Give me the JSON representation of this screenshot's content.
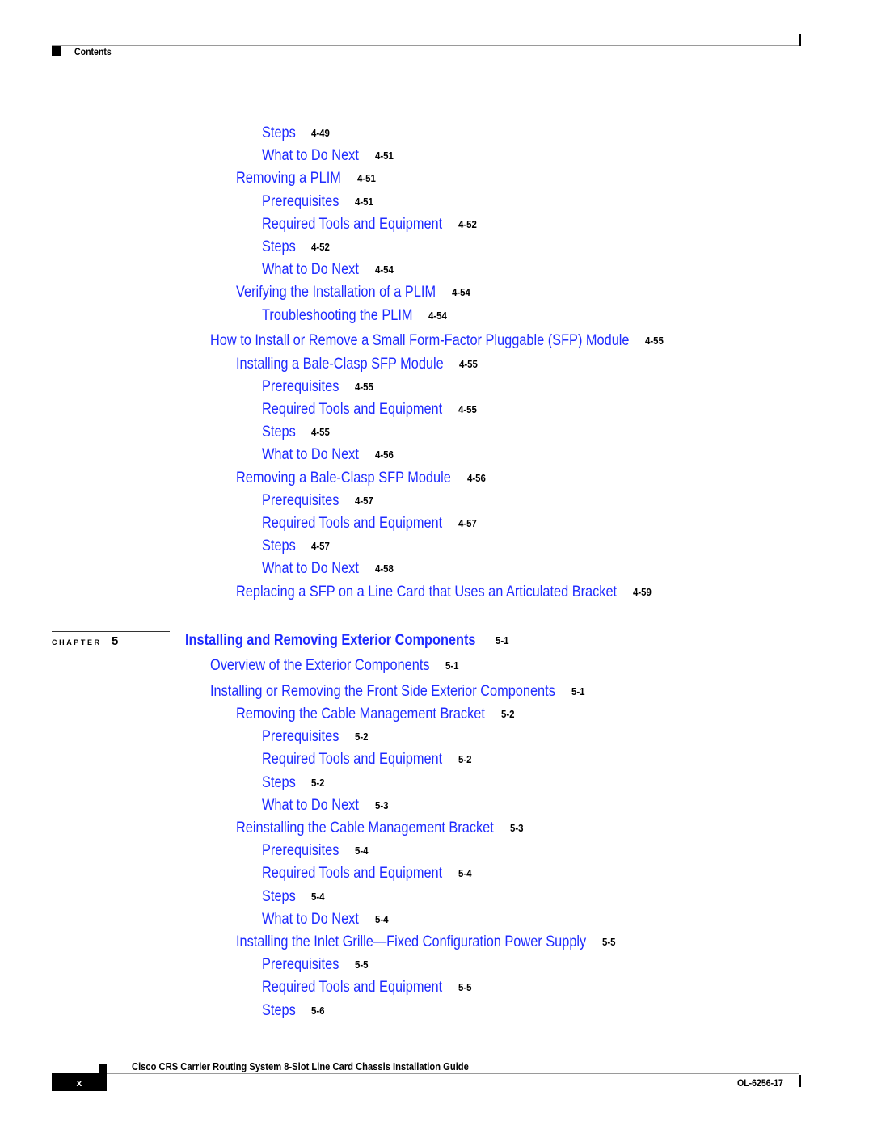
{
  "header": {
    "section_title": "Contents"
  },
  "toc_continued": [
    {
      "level": 3,
      "label": "Steps",
      "page": "4-49"
    },
    {
      "level": 3,
      "label": "What to Do Next",
      "page": "4-51"
    },
    {
      "level": 2,
      "label": "Removing a PLIM",
      "page": "4-51"
    },
    {
      "level": 3,
      "label": "Prerequisites",
      "page": "4-51"
    },
    {
      "level": 3,
      "label": "Required Tools and Equipment",
      "page": "4-52"
    },
    {
      "level": 3,
      "label": "Steps",
      "page": "4-52"
    },
    {
      "level": 3,
      "label": "What to Do Next",
      "page": "4-54"
    },
    {
      "level": 2,
      "label": "Verifying the Installation of a PLIM",
      "page": "4-54"
    },
    {
      "level": 3,
      "label": "Troubleshooting the PLIM",
      "page": "4-54"
    },
    {
      "level": 1,
      "label": "How to Install or Remove a Small Form-Factor Pluggable (SFP) Module",
      "page": "4-55"
    },
    {
      "level": 2,
      "label": "Installing a Bale-Clasp SFP Module",
      "page": "4-55"
    },
    {
      "level": 3,
      "label": "Prerequisites",
      "page": "4-55"
    },
    {
      "level": 3,
      "label": "Required Tools and Equipment",
      "page": "4-55"
    },
    {
      "level": 3,
      "label": "Steps",
      "page": "4-55"
    },
    {
      "level": 3,
      "label": "What to Do Next",
      "page": "4-56"
    },
    {
      "level": 2,
      "label": "Removing a Bale-Clasp SFP Module",
      "page": "4-56"
    },
    {
      "level": 3,
      "label": "Prerequisites",
      "page": "4-57"
    },
    {
      "level": 3,
      "label": "Required Tools and Equipment",
      "page": "4-57"
    },
    {
      "level": 3,
      "label": "Steps",
      "page": "4-57"
    },
    {
      "level": 3,
      "label": "What to Do Next",
      "page": "4-58"
    },
    {
      "level": 2,
      "label": "Replacing a SFP on a Line Card that Uses an Articulated Bracket",
      "page": "4-59"
    }
  ],
  "chapter": {
    "word": "CHAPTER",
    "number": "5",
    "title": "Installing and Removing Exterior Components",
    "page": "5-1"
  },
  "toc_chapter5": [
    {
      "level": 1,
      "label": "Overview of the Exterior Components",
      "page": "5-1"
    },
    {
      "level": 1,
      "label": "Installing or Removing the Front Side Exterior Components",
      "page": "5-1"
    },
    {
      "level": 2,
      "label": "Removing the Cable Management Bracket",
      "page": "5-2"
    },
    {
      "level": 3,
      "label": "Prerequisites",
      "page": "5-2"
    },
    {
      "level": 3,
      "label": "Required Tools and Equipment",
      "page": "5-2"
    },
    {
      "level": 3,
      "label": "Steps",
      "page": "5-2"
    },
    {
      "level": 3,
      "label": "What to Do Next",
      "page": "5-3"
    },
    {
      "level": 2,
      "label": "Reinstalling the Cable Management Bracket",
      "page": "5-3"
    },
    {
      "level": 3,
      "label": "Prerequisites",
      "page": "5-4"
    },
    {
      "level": 3,
      "label": "Required Tools and Equipment",
      "page": "5-4"
    },
    {
      "level": 3,
      "label": "Steps",
      "page": "5-4"
    },
    {
      "level": 3,
      "label": "What to Do Next",
      "page": "5-4"
    },
    {
      "level": 2,
      "label": "Installing the Inlet Grille—Fixed Configuration Power Supply",
      "page": "5-5"
    },
    {
      "level": 3,
      "label": "Prerequisites",
      "page": "5-5"
    },
    {
      "level": 3,
      "label": "Required Tools and Equipment",
      "page": "5-5"
    },
    {
      "level": 3,
      "label": "Steps",
      "page": "5-6"
    }
  ],
  "footer": {
    "book_title": "Cisco CRS Carrier Routing System 8-Slot Line Card Chassis Installation Guide",
    "page_number": "x",
    "doc_number": "OL-6256-17"
  },
  "colors": {
    "link": "#1f2bff",
    "text": "#000000",
    "rule": "#9a9a9a"
  }
}
